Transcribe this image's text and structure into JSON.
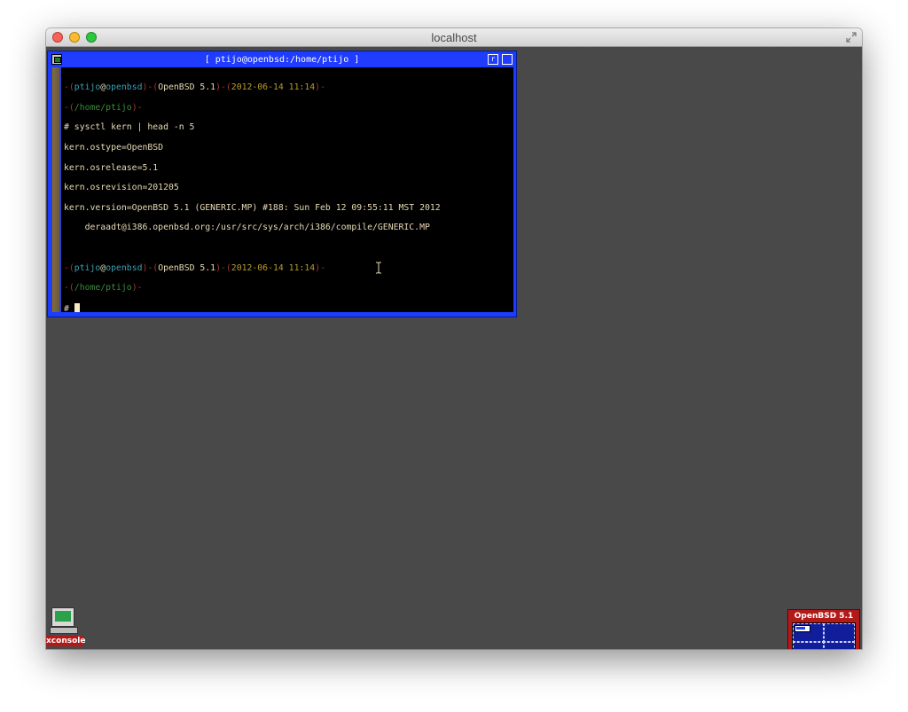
{
  "mac_window": {
    "title": "localhost"
  },
  "xterm": {
    "title": "[ ptijo@openbsd:/home/ptijo ]",
    "minimize_label": "r",
    "maximize_label": ""
  },
  "terminal": {
    "prompt1": {
      "open": "-(",
      "user": "ptijo",
      "at": "@",
      "host": "openbsd",
      "sep1": ")-(",
      "os": "OpenBSD 5.1",
      "sep2": ")-(",
      "date": "2012-06-14 11:14",
      "close": ")-",
      "path_open": "-(",
      "path": "/home/ptijo",
      "path_close": ")-"
    },
    "command": "# sysctl kern | head -n 5",
    "output": [
      "kern.ostype=OpenBSD",
      "kern.osrelease=5.1",
      "kern.osrevision=201205",
      "kern.version=OpenBSD 5.1 (GENERIC.MP) #188: Sun Feb 12 09:55:11 MST 2012",
      "    deraadt@i386.openbsd.org:/usr/src/sys/arch/i386/compile/GENERIC.MP"
    ],
    "prompt2": {
      "open": "-(",
      "user": "ptijo",
      "at": "@",
      "host": "openbsd",
      "sep1": ")-(",
      "os": "OpenBSD 5.1",
      "sep2": ")-(",
      "date": "2012-06-14 11:14",
      "close": ")-",
      "path_open": "-(",
      "path": "/home/ptijo",
      "path_close": ")-"
    },
    "input_prompt": "# "
  },
  "xconsole": {
    "label": "xconsole"
  },
  "pager": {
    "title": "OpenBSD 5.1"
  },
  "colors": {
    "xterm_frame": "#1c3cff",
    "terminal_bg": "#000000",
    "terminal_fg": "#e6d9b4",
    "prompt_dim": "#a33a30",
    "prompt_user": "#3aa0b0",
    "prompt_date": "#b69b2c",
    "prompt_path": "#3a8a3a",
    "pager_bg": "#b21a1a",
    "pager_grid": "#101e9a"
  },
  "icons": [
    "xterm-menu-icon",
    "ibeam-cursor-icon",
    "xconsole-icon",
    "fullscreen-icon"
  ]
}
